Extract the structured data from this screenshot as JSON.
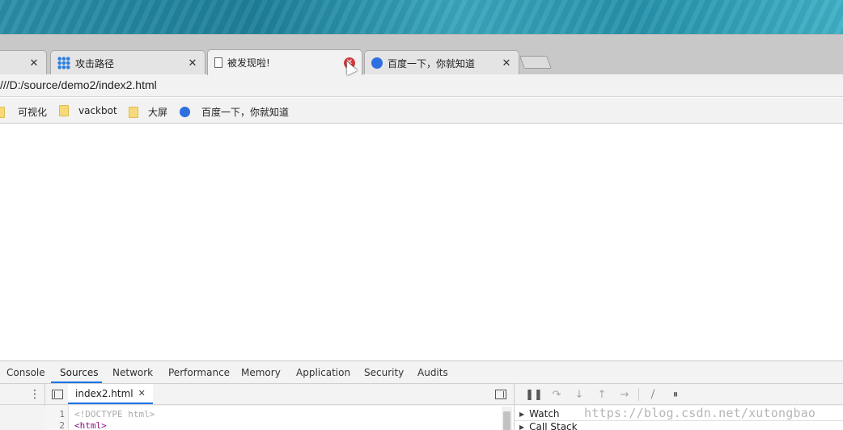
{
  "tabs": [
    {
      "title": "",
      "close": "✕"
    },
    {
      "title": "攻击路径",
      "close": "✕"
    },
    {
      "title": "被发现啦!",
      "close": "✕"
    },
    {
      "title": "百度一下，你就知道",
      "close": "✕"
    }
  ],
  "address": {
    "url": "///D:/source/demo2/index2.html"
  },
  "bookmarks": [
    {
      "label": "可视化",
      "icon": "folder-icon"
    },
    {
      "label": "vackbot",
      "icon": "folder-icon"
    },
    {
      "label": "大屏",
      "icon": "folder-icon"
    },
    {
      "label": "百度一下，你就知道",
      "icon": "baidu-paw-icon"
    }
  ],
  "devtools": {
    "tabs": [
      "Console",
      "Sources",
      "Network",
      "Performance",
      "Memory",
      "Application",
      "Security",
      "Audits"
    ],
    "active_tab": "Sources",
    "open_file": {
      "name": "index2.html",
      "close": "✕"
    },
    "code_lines": [
      {
        "num": "1",
        "text": "<!DOCTYPE html>"
      },
      {
        "num": "2",
        "text": "<html>"
      }
    ],
    "side_sections": [
      "Watch",
      "Call Stack"
    ]
  },
  "watermark": "https://blog.csdn.net/xutongbao"
}
